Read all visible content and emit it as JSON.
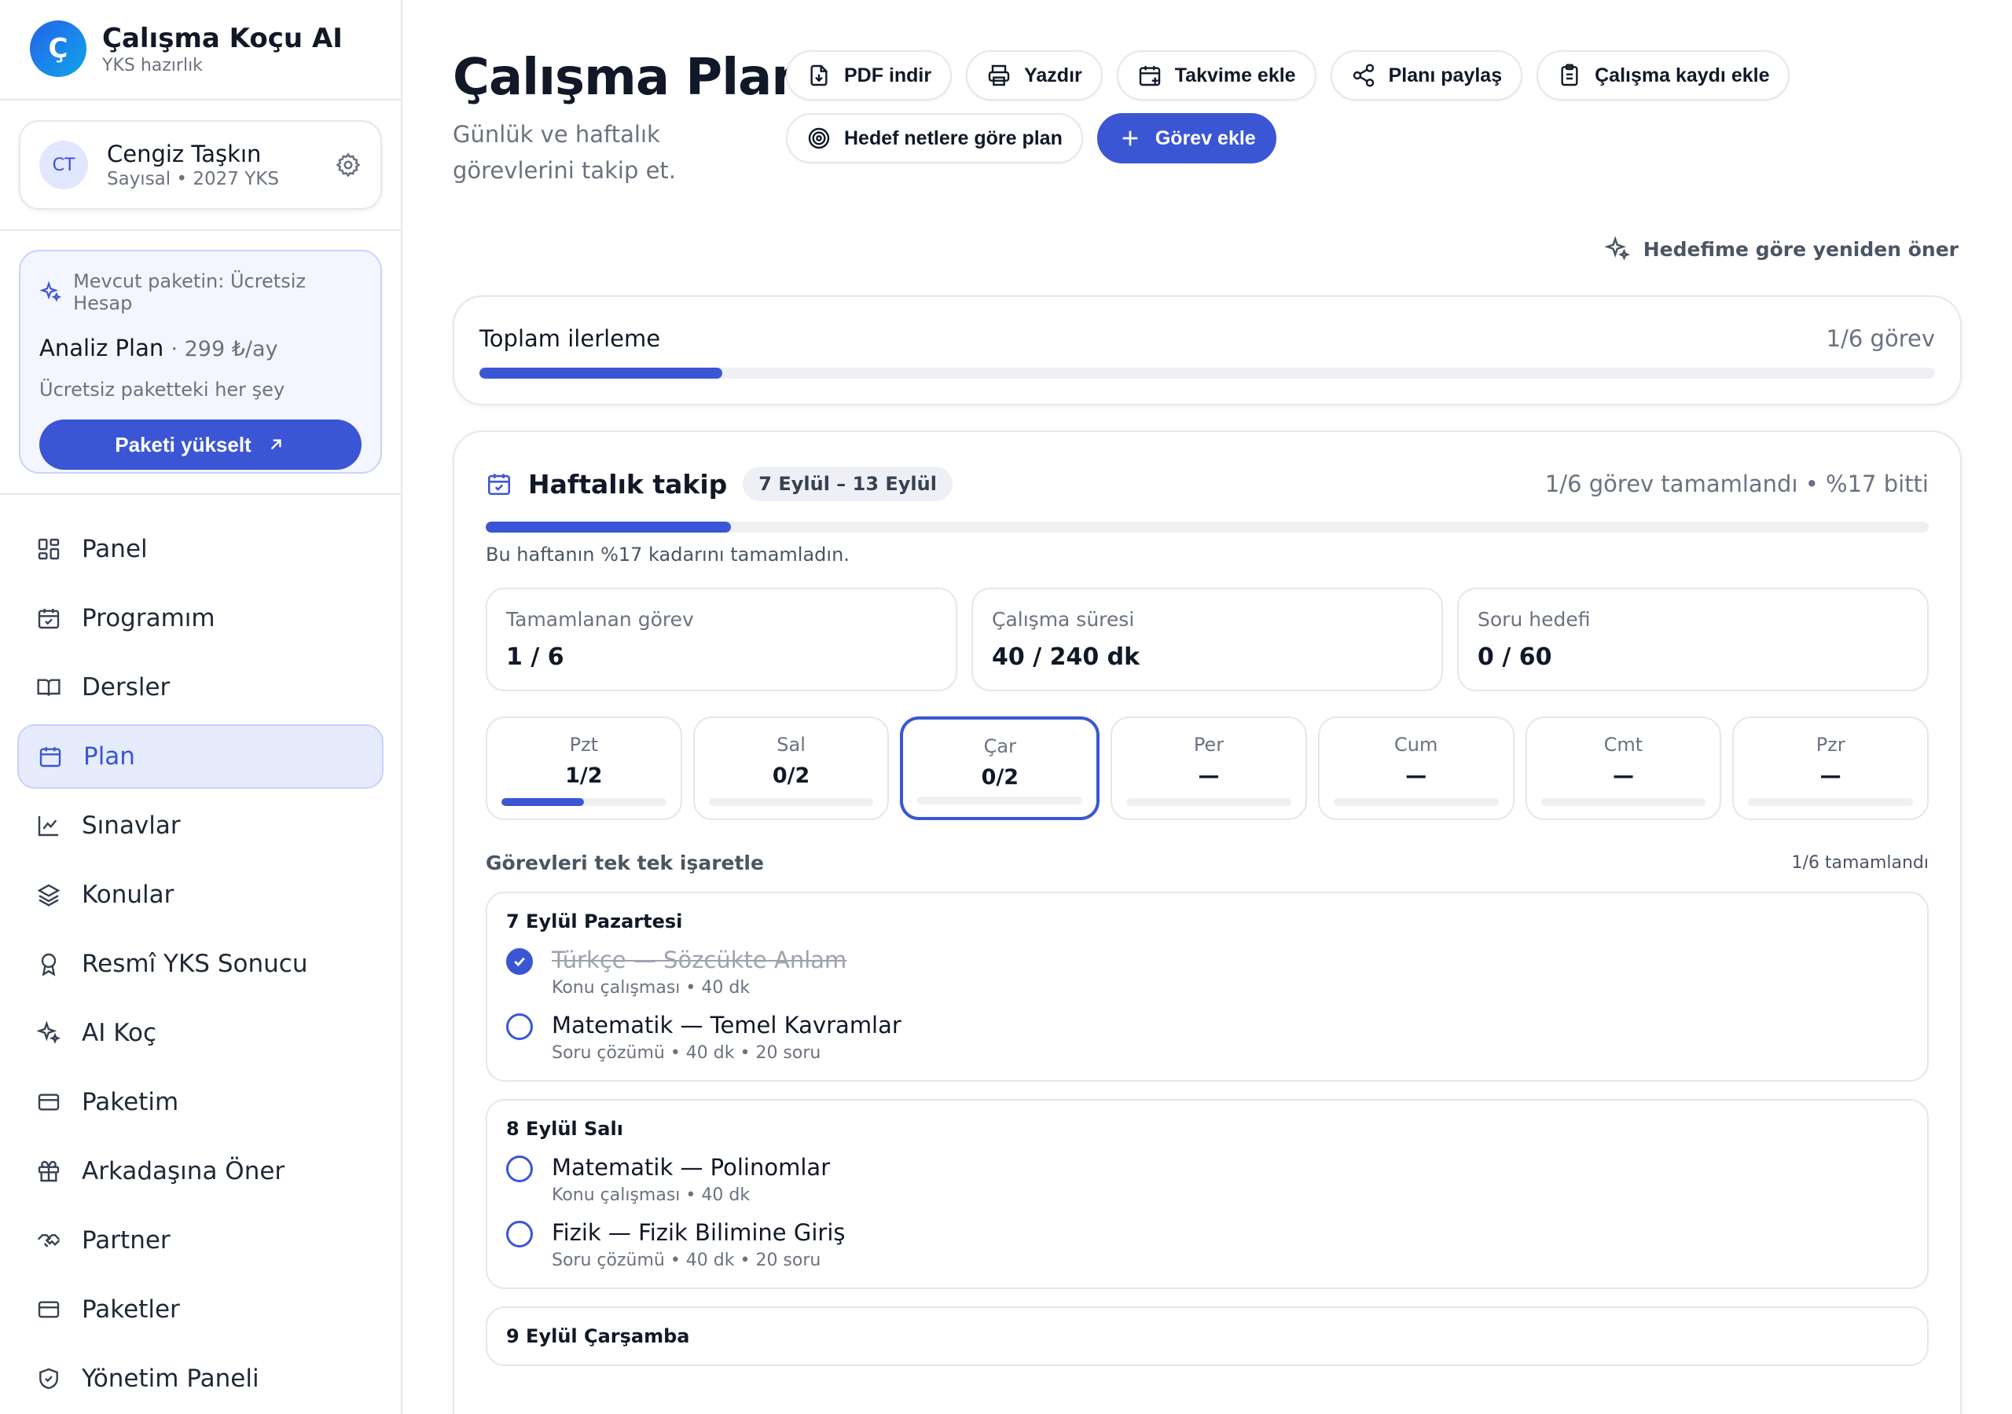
{
  "brand": {
    "logo_letter": "Ç",
    "title": "Çalışma Koçu AI",
    "subtitle": "YKS hazırlık"
  },
  "user": {
    "initials": "CT",
    "name": "Cengiz Taşkın",
    "meta": "Sayısal • 2027 YKS"
  },
  "package": {
    "current": "Mevcut paketin: Ücretsiz Hesap",
    "plan_name": "Analiz Plan",
    "plan_price": "· 299 ₺/ay",
    "description": "Ücretsiz paketteki her şey",
    "upgrade_label": "Paketi yükselt"
  },
  "nav": {
    "items": [
      {
        "label": "Panel",
        "icon": "grid-icon"
      },
      {
        "label": "Programım",
        "icon": "calendar-check-icon"
      },
      {
        "label": "Dersler",
        "icon": "book-icon"
      },
      {
        "label": "Plan",
        "icon": "calendar-icon"
      },
      {
        "label": "Sınavlar",
        "icon": "chart-line-icon"
      },
      {
        "label": "Konular",
        "icon": "layers-icon"
      },
      {
        "label": "Resmî YKS Sonucu",
        "icon": "award-icon"
      },
      {
        "label": "AI Koç",
        "icon": "sparkles-icon"
      },
      {
        "label": "Paketim",
        "icon": "card-icon"
      },
      {
        "label": "Arkadaşına Öner",
        "icon": "gift-icon"
      },
      {
        "label": "Partner",
        "icon": "handshake-icon"
      },
      {
        "label": "Paketler",
        "icon": "card-icon"
      },
      {
        "label": "Yönetim Paneli",
        "icon": "shield-icon"
      }
    ],
    "active_index": 3
  },
  "page": {
    "title": "Çalışma Planı",
    "subtitle": "Günlük ve haftalık görevlerini takip et."
  },
  "actions": {
    "pdf": "PDF indir",
    "print": "Yazdır",
    "calendar": "Takvime ekle",
    "share": "Planı paylaş",
    "log": "Çalışma kaydı ekle",
    "target_plan": "Hedef netlere göre plan",
    "add_task": "Görev ekle"
  },
  "resuggest": "Hedefime göre yeniden öner",
  "total_progress": {
    "label": "Toplam ilerleme",
    "value": "1/6 görev",
    "fraction": 0.167
  },
  "weekly": {
    "title": "Haftalık takip",
    "range": "7 Eylül – 13 Eylül",
    "summary": "1/6 görev tamamlandı • %17 bitti",
    "fraction": 0.17,
    "note": "Bu haftanın %17 kadarını tamamladın.",
    "stats": [
      {
        "label": "Tamamlanan görev",
        "value": "1 / 6"
      },
      {
        "label": "Çalışma süresi",
        "value": "40 / 240 dk"
      },
      {
        "label": "Soru hedefi",
        "value": "0 / 60"
      }
    ],
    "days": [
      {
        "name": "Pzt",
        "value": "1/2",
        "fraction": 0.5
      },
      {
        "name": "Sal",
        "value": "0/2",
        "fraction": 0
      },
      {
        "name": "Çar",
        "value": "0/2",
        "fraction": 0
      },
      {
        "name": "Per",
        "value": "—",
        "fraction": 0
      },
      {
        "name": "Cum",
        "value": "—",
        "fraction": 0
      },
      {
        "name": "Cmt",
        "value": "—",
        "fraction": 0
      },
      {
        "name": "Pzr",
        "value": "—",
        "fraction": 0
      }
    ],
    "selected_day": 2
  },
  "tasks": {
    "title": "Görevleri tek tek işaretle",
    "count": "1/6 tamamlandı",
    "groups": [
      {
        "title": "7 Eylül Pazartesi",
        "items": [
          {
            "name": "Türkçe — Sözcükte Anlam",
            "meta": "Konu çalışması • 40 dk",
            "done": true
          },
          {
            "name": "Matematik — Temel Kavramlar",
            "meta": "Soru çözümü • 40 dk • 20 soru",
            "done": false
          }
        ]
      },
      {
        "title": "8 Eylül Salı",
        "items": [
          {
            "name": "Matematik — Polinomlar",
            "meta": "Konu çalışması • 40 dk",
            "done": false
          },
          {
            "name": "Fizik — Fizik Bilimine Giriş",
            "meta": "Soru çözümü • 40 dk • 20 soru",
            "done": false
          }
        ]
      },
      {
        "title": "9 Eylül Çarşamba",
        "items": []
      }
    ]
  },
  "colors": {
    "accent": "#3b56d4",
    "accent_soft": "#e6ecfc"
  }
}
